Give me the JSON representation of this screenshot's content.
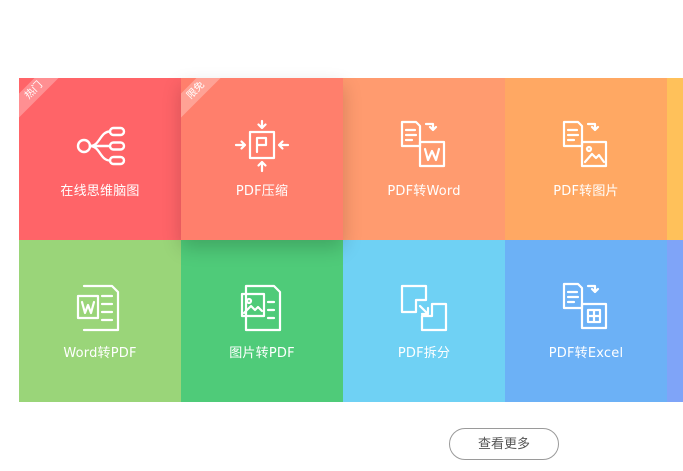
{
  "tiles": [
    {
      "label": "在线思维脑图",
      "badge": "热门",
      "color": "#ff6468",
      "icon": "mind-map-icon"
    },
    {
      "label": "PDF压缩",
      "badge": "限免",
      "color": "#ff7f6c",
      "icon": "compress-icon"
    },
    {
      "label": "PDF转Word",
      "badge": "",
      "color": "#ff9b6f",
      "icon": "pdf-to-word-icon"
    },
    {
      "label": "PDF转图片",
      "badge": "",
      "color": "#ffa863",
      "icon": "pdf-to-image-icon"
    },
    {
      "label": "Word转PDF",
      "badge": "",
      "color": "#9ad579",
      "icon": "word-to-pdf-icon"
    },
    {
      "label": "图片转PDF",
      "badge": "",
      "color": "#4fcb79",
      "icon": "image-to-pdf-icon"
    },
    {
      "label": "PDF拆分",
      "badge": "",
      "color": "#6fd1f4",
      "icon": "split-icon"
    },
    {
      "label": "PDF转Excel",
      "badge": "",
      "color": "#6cb1f6",
      "icon": "pdf-to-excel-icon"
    }
  ],
  "edge_colors": [
    "#ffc15a",
    "#7fa4f8"
  ],
  "more_button": {
    "label": "查看更多"
  }
}
